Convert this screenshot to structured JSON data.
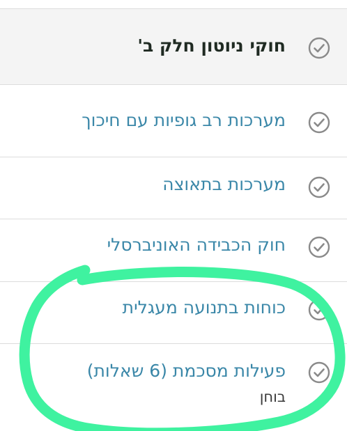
{
  "section": {
    "title": "חוקי ניוטון חלק ב'",
    "title_icon": "check-circle-icon"
  },
  "lessons": [
    {
      "label": "מערכות רב גופיות עם חיכוך",
      "icon": "check-circle-icon"
    },
    {
      "label": "מערכות בתאוצה",
      "icon": "check-circle-icon"
    },
    {
      "label": "חוק הכבידה האוניברסלי",
      "icon": "check-circle-icon"
    },
    {
      "label": "כוחות בתנועה מעגלית",
      "icon": "check-circle-icon"
    },
    {
      "label": "פעילות מסכמת (6 שאלות)",
      "sublabel": "בוחן",
      "icon": "check-circle-icon"
    }
  ],
  "colors": {
    "link": "#3a87a8",
    "header_bg": "#f4f4f4",
    "divider": "#dcdcdc",
    "check": "#8a8a8a",
    "highlight_marker": "#3ff2a0"
  }
}
